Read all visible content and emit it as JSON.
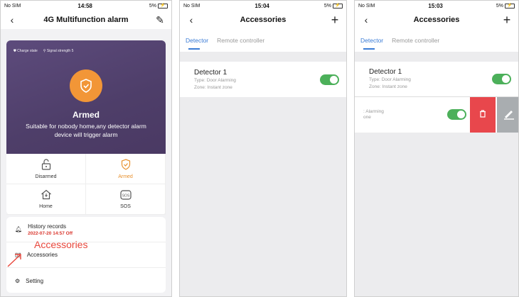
{
  "panel1": {
    "status": {
      "carrier": "No SIM",
      "time": "14:58",
      "battery": "5%"
    },
    "nav": {
      "title": "4G Multifunction alarm"
    },
    "hero": {
      "charge_label": "Charge state",
      "signal_label": "Signal strength 5",
      "state": "Armed",
      "description": "Suitable for nobody home,any detector alarm device will trigger alarm"
    },
    "modes": [
      {
        "label": "Disarmed"
      },
      {
        "label": "Armed"
      },
      {
        "label": "Home"
      },
      {
        "label": "SOS"
      }
    ],
    "list": {
      "history_title": "History records",
      "history_sub": "2022-07-20 14:57 Off",
      "accessories": "Accessories",
      "setting": "Setting"
    },
    "annotation": "Accessories"
  },
  "panel2": {
    "status": {
      "carrier": "No SIM",
      "time": "15:04",
      "battery": "5%"
    },
    "nav": {
      "title": "Accessories"
    },
    "tabs": {
      "detector": "Detector",
      "remote": "Remote controller"
    },
    "detector": {
      "name": "Detector 1",
      "type": "Type: Door Alarming",
      "zone": "Zone: Instant zone"
    }
  },
  "panel3": {
    "status": {
      "carrier": "No SIM",
      "time": "15:03",
      "battery": "5%"
    },
    "nav": {
      "title": "Accessories"
    },
    "tabs": {
      "detector": "Detector",
      "remote": "Remote controller"
    },
    "detector": {
      "name": "Detector 1",
      "type": "Type: Door Alarming",
      "zone": "Zone: Instant zone"
    },
    "swiped": {
      "type": ": Alarming",
      "zone": "one"
    }
  },
  "colors": {
    "accent": "#3a7bd5",
    "armed": "#f29637",
    "toggle": "#4cb05a",
    "delete": "#e8474c"
  }
}
